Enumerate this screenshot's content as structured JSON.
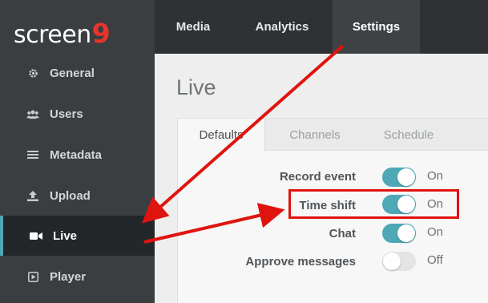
{
  "brand": {
    "logo_text": "screen",
    "logo_digit": "9"
  },
  "topnav": {
    "tabs": [
      {
        "label": "Media",
        "active": false
      },
      {
        "label": "Analytics",
        "active": false
      },
      {
        "label": "Settings",
        "active": true
      }
    ]
  },
  "sidebar": {
    "items": [
      {
        "label": "General",
        "icon": "gear-icon",
        "active": false
      },
      {
        "label": "Users",
        "icon": "users-icon",
        "active": false
      },
      {
        "label": "Metadata",
        "icon": "list-icon",
        "active": false
      },
      {
        "label": "Upload",
        "icon": "upload-icon",
        "active": false
      },
      {
        "label": "Live",
        "icon": "video-camera-icon",
        "active": true
      },
      {
        "label": "Player",
        "icon": "play-square-icon",
        "active": false
      }
    ]
  },
  "main": {
    "title": "Live",
    "subtabs": [
      {
        "label": "Defaults",
        "active": true
      },
      {
        "label": "Channels",
        "active": false
      },
      {
        "label": "Schedule",
        "active": false
      }
    ],
    "settings": [
      {
        "label": "Record event",
        "enabled": true,
        "state_label": "On"
      },
      {
        "label": "Time shift",
        "enabled": true,
        "state_label": "On"
      },
      {
        "label": "Chat",
        "enabled": true,
        "state_label": "On"
      },
      {
        "label": "Approve messages",
        "enabled": false,
        "state_label": "Off"
      }
    ]
  },
  "colors": {
    "accent": "#4ea8b5",
    "annotation": "#e0140f",
    "sidebar_bg": "#3a3e41",
    "logo_digit": "#e8352c"
  }
}
